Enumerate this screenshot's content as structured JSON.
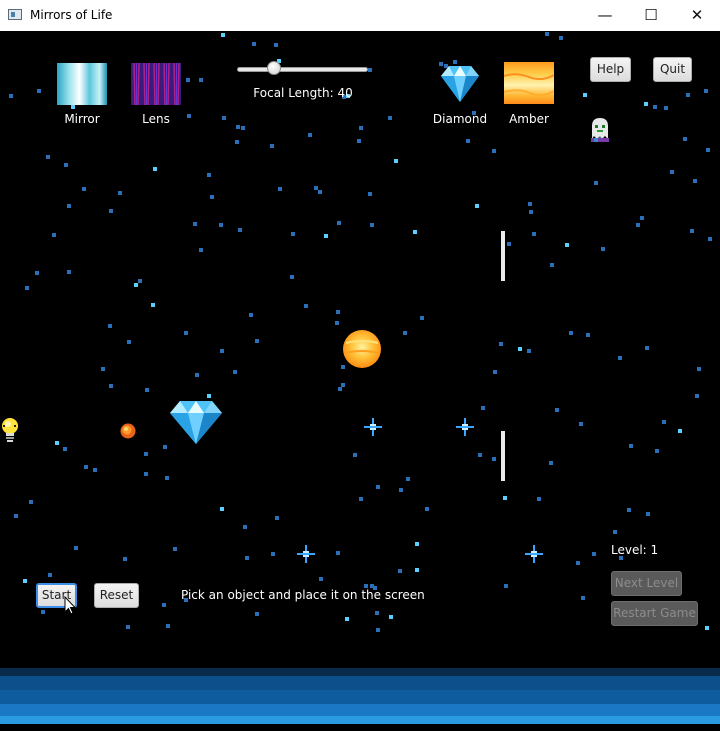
{
  "window": {
    "title": "Mirrors of Life",
    "minimize_glyph": "—",
    "maximize_glyph": "☐",
    "close_glyph": "✕"
  },
  "toolbox": {
    "mirror_label": "Mirror",
    "lens_label": "Lens",
    "diamond_label": "Diamond",
    "amber_label": "Amber"
  },
  "focal": {
    "label": "Focal Length: 40",
    "value": 40,
    "slider_fraction": 0.26
  },
  "buttons": {
    "help": "Help",
    "quit": "Quit",
    "start": "Start",
    "reset": "Reset",
    "next_level": "Next Level",
    "restart_game": "Restart Game"
  },
  "status": {
    "instruction": "Pick an object and place it on the screen",
    "level": "Level: 1"
  },
  "icons": [
    "mirror-tile-icon",
    "lens-tile-icon",
    "diamond-tile-icon",
    "amber-tile-icon",
    "ghost-icon",
    "lightbulb-icon",
    "sun-icon",
    "fire-orb-icon",
    "diamond-icon",
    "sparkle-icon",
    "cursor-icon"
  ],
  "colors": {
    "background": "#000000",
    "star": "#2a6fb8",
    "star_bright": "#5ad0ff",
    "water_1": "#0a2a4a",
    "water_2": "#0d4f8a",
    "water_3": "#1a78c4",
    "water_4": "#2a9be0"
  }
}
